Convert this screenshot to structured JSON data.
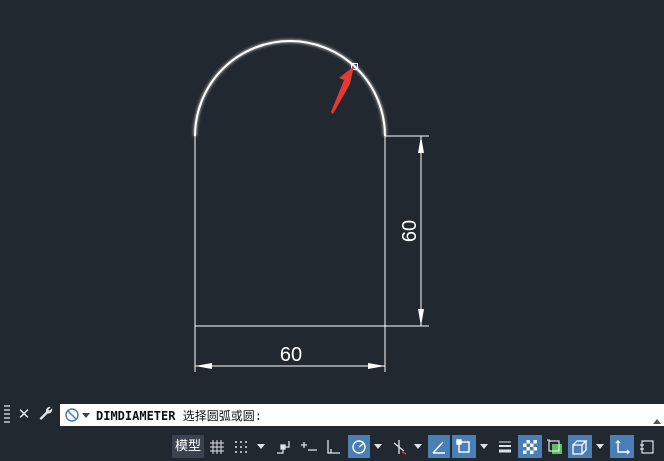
{
  "drawing": {
    "dim_horizontal": "60",
    "dim_vertical": "60",
    "line_color": "#ffffff",
    "arrow_color": "#e53935"
  },
  "command_line": {
    "command": "DIMDIAMETER",
    "prompt": "选择圆弧或圆:"
  },
  "status_bar": {
    "model_tab": "模型"
  },
  "icons": [
    "close-icon",
    "wrench-icon",
    "command-history-icon",
    "grid-icon",
    "snap-icon",
    "infer-icon",
    "ortho-icon",
    "polar-icon",
    "isodraft-icon",
    "osnap-track-icon",
    "osnap-icon",
    "lineweight-icon",
    "transparency-icon",
    "selection-cycling-icon",
    "3d-osnap-icon",
    "ucs-icon",
    "annotation-icon"
  ]
}
